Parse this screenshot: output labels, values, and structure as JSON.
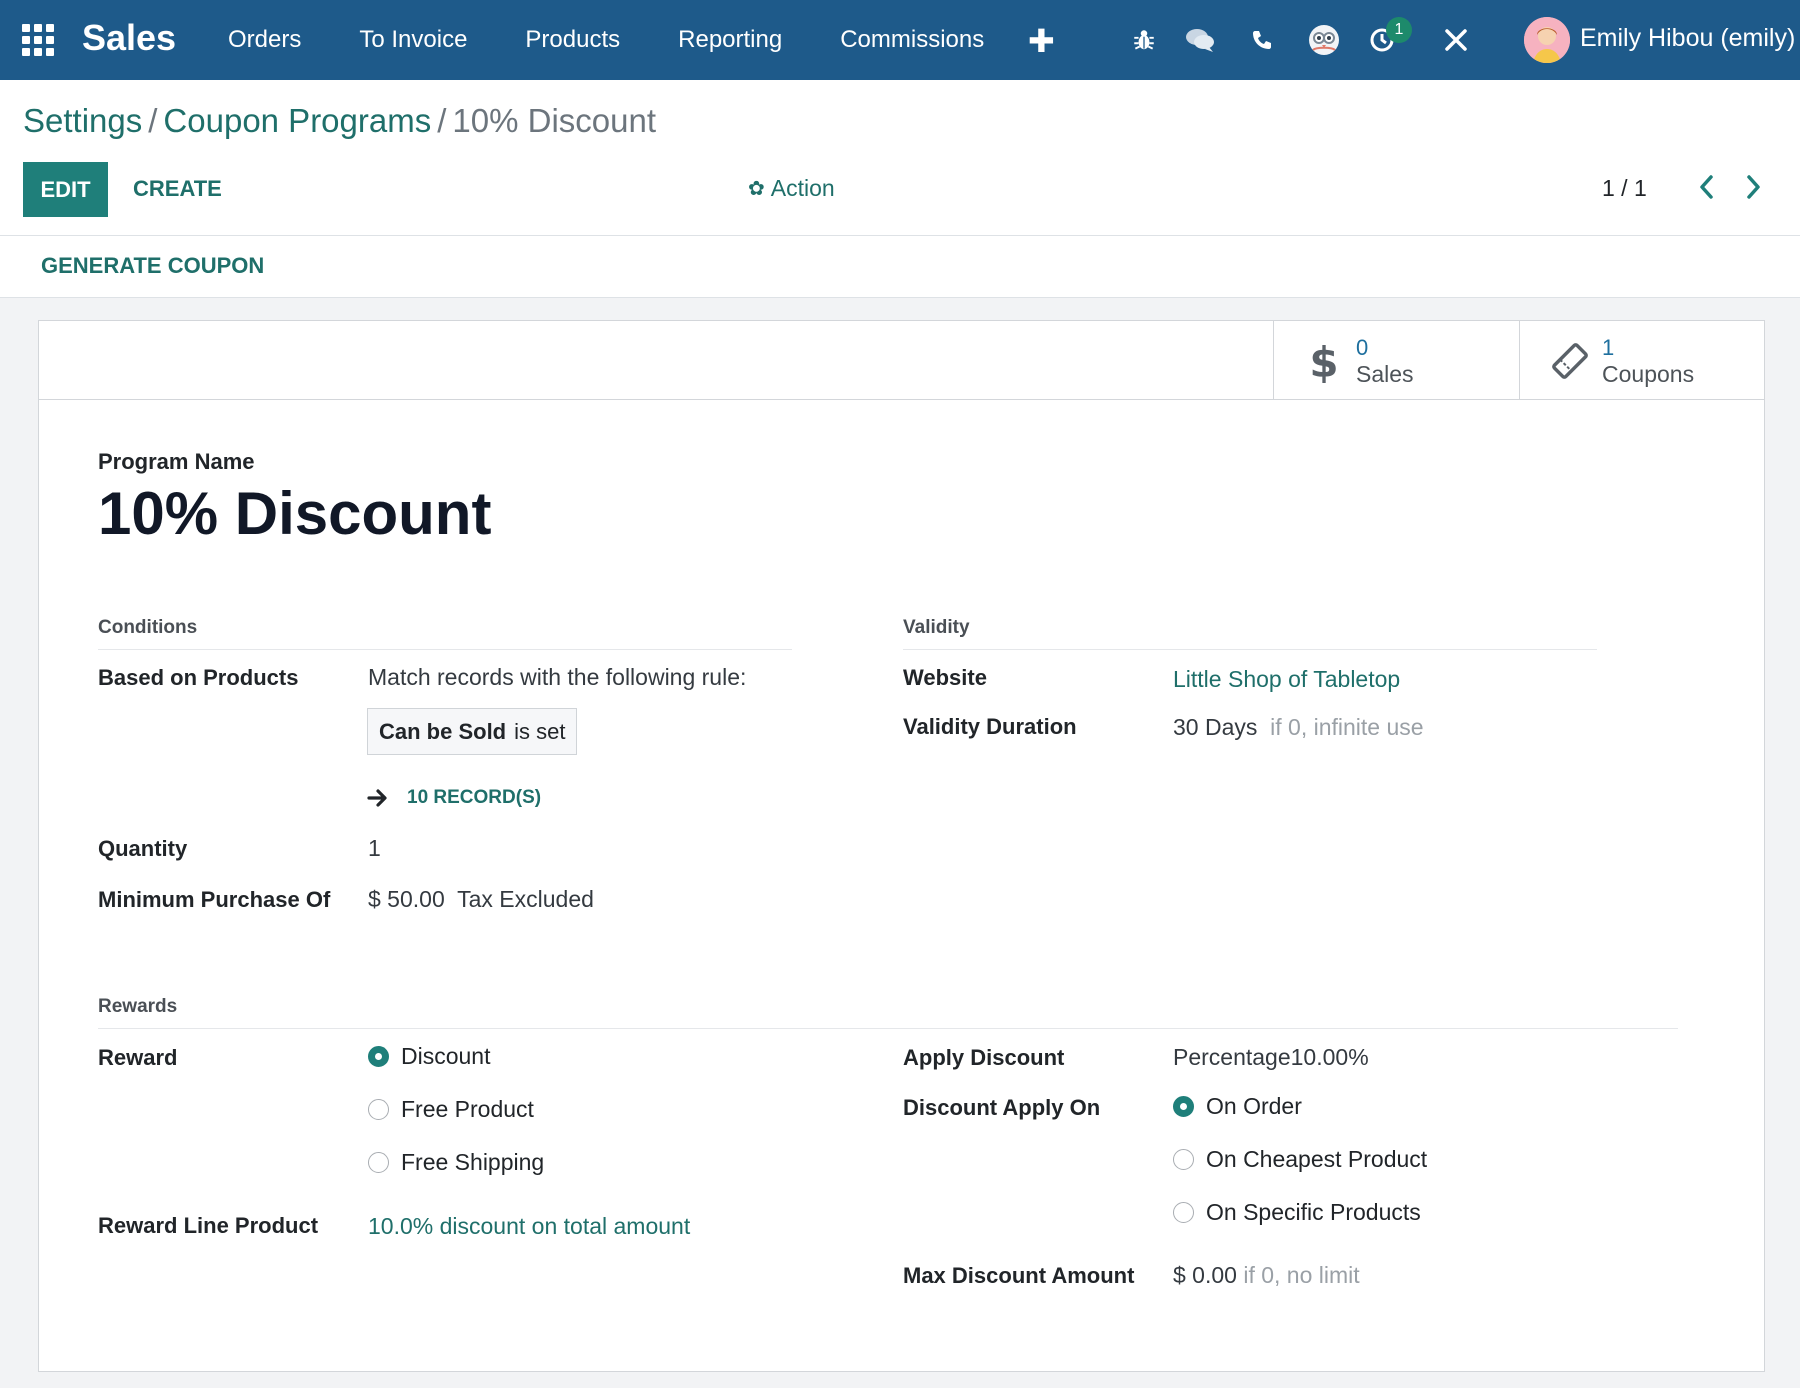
{
  "navbar": {
    "brand": "Sales",
    "menu": [
      "Orders",
      "To Invoice",
      "Products",
      "Reporting",
      "Commissions"
    ],
    "activity_badge": "1",
    "user_name": "Emily Hibou (emily)"
  },
  "breadcrumb": {
    "items": [
      "Settings",
      "Coupon Programs"
    ],
    "separator": "/",
    "current": "10% Discount"
  },
  "toolbar": {
    "edit_label": "EDIT",
    "create_label": "CREATE",
    "action_label": "Action",
    "pager": "1 / 1"
  },
  "statusbar": {
    "generate_label": "GENERATE COUPON"
  },
  "stat_buttons": {
    "sales": {
      "value": "0",
      "label": "Sales",
      "icon": "dollar-icon"
    },
    "coupons": {
      "value": "1",
      "label": "Coupons",
      "icon": "ticket-icon"
    }
  },
  "form": {
    "program_name_label": "Program Name",
    "program_name": "10% Discount",
    "conditions": {
      "title": "Conditions",
      "based_on_products_label": "Based on Products",
      "rule_text": "Match records with the following rule:",
      "rule_field": "Can be Sold",
      "rule_operator": "is set",
      "records_link": "10 RECORD(S)",
      "quantity_label": "Quantity",
      "quantity": "1",
      "min_purchase_label": "Minimum Purchase Of",
      "min_purchase": "$ 50.00",
      "tax_mode": "Tax Excluded"
    },
    "validity": {
      "title": "Validity",
      "website_label": "Website",
      "website": "Little Shop of Tabletop",
      "duration_label": "Validity Duration",
      "duration": "30 Days",
      "duration_hint": "if 0, infinite use"
    },
    "rewards": {
      "title": "Rewards",
      "reward_label": "Reward",
      "reward_options": [
        "Discount",
        "Free Product",
        "Free Shipping"
      ],
      "reward_selected": "Discount",
      "reward_line_label": "Reward Line Product",
      "reward_line_product": "10.0% discount on total amount",
      "apply_discount_label": "Apply Discount",
      "apply_discount": "Percentage10.00%",
      "apply_on_label": "Discount Apply On",
      "apply_on_options": [
        "On Order",
        "On Cheapest Product",
        "On Specific Products"
      ],
      "apply_on_selected": "On Order",
      "max_discount_label": "Max Discount Amount",
      "max_discount": "$ 0.00",
      "max_discount_hint": "if 0, no limit"
    }
  },
  "colors": {
    "navbar": "#1e5a8a",
    "primary": "#1f7f7a",
    "link": "#1f6f6a"
  }
}
